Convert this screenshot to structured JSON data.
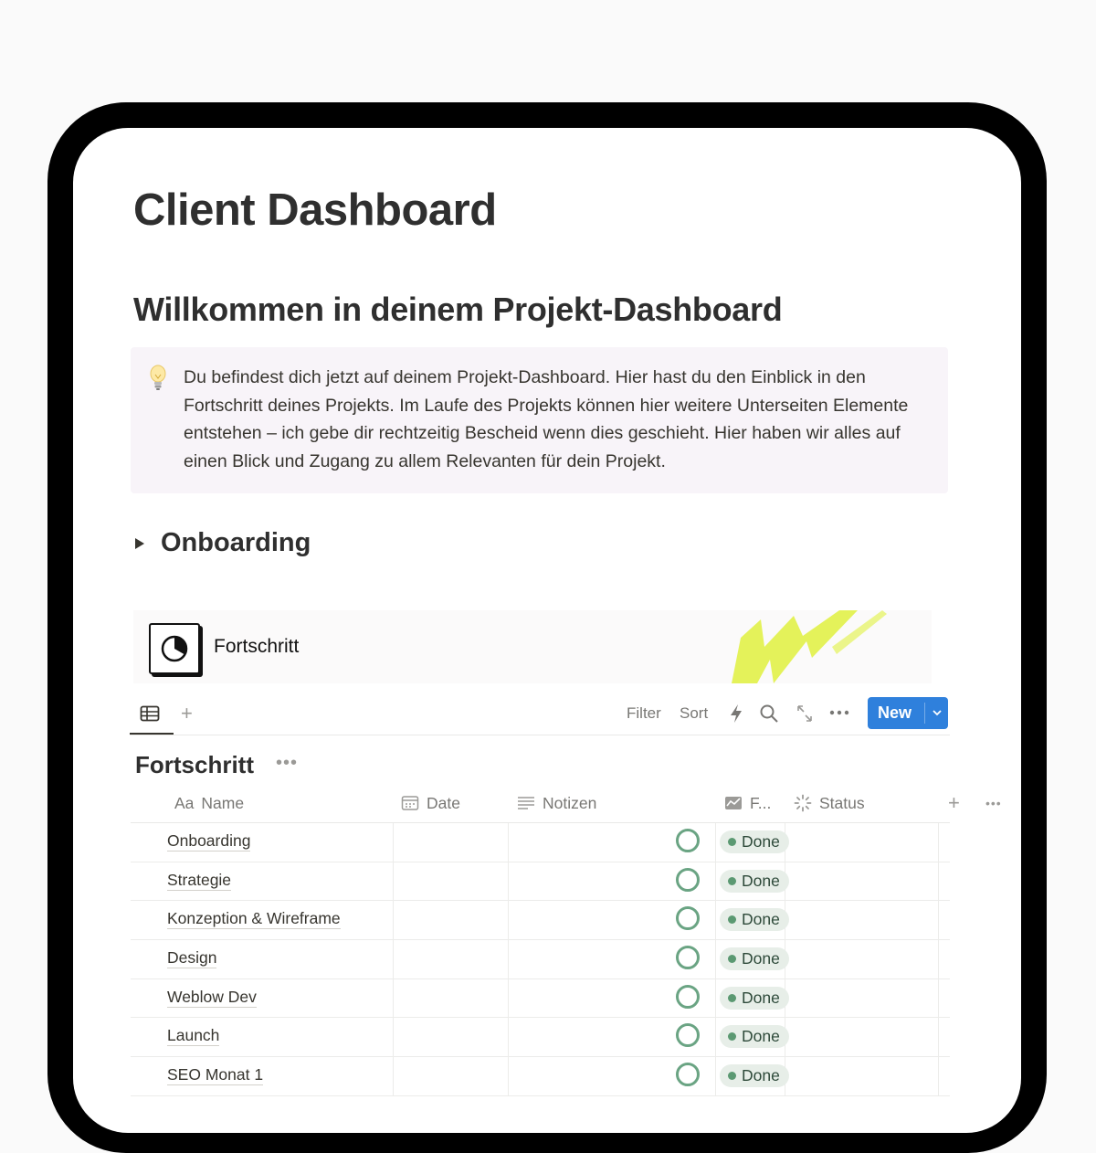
{
  "page": {
    "title": "Client Dashboard",
    "welcome_heading": "Willkommen in deinem Projekt-Dashboard",
    "callout": {
      "icon": "lightbulb-icon",
      "text": "Du befindest dich jetzt auf deinem Projekt-Dashboard. Hier hast du den Einblick in den Fortschritt deines Projekts. Im Laufe des Projekts können hier weitere Unterseiten Elemente entstehen – ich gebe dir rechtzeitig Bescheid wenn dies geschieht. Hier haben wir alles auf einen Blick und Zugang zu allem Relevanten für dein Projekt."
    },
    "toggle_heading": "Onboarding"
  },
  "banner": {
    "title": "Fortschritt",
    "icon": "pie-chart-icon",
    "accent": "#e4f25a"
  },
  "toolbar": {
    "filter": "Filter",
    "sort": "Sort",
    "new_button": "New",
    "accent": "#2f80dc"
  },
  "database": {
    "title": "Fortschritt",
    "columns": {
      "name_prefix": "Aa",
      "name": "Name",
      "date": "Date",
      "notes": "Notizen",
      "progress": "F...",
      "status": "Status"
    },
    "rows": [
      {
        "name": "Onboarding",
        "status": "Done"
      },
      {
        "name": "Strategie",
        "status": "Done"
      },
      {
        "name": "Konzeption & Wireframe",
        "status": "Done"
      },
      {
        "name": "Design",
        "status": "Done"
      },
      {
        "name": "Weblow Dev",
        "status": "Done"
      },
      {
        "name": "Launch",
        "status": "Done"
      },
      {
        "name": "SEO Monat 1",
        "status": "Done"
      }
    ],
    "status_color": "#5b9972"
  }
}
